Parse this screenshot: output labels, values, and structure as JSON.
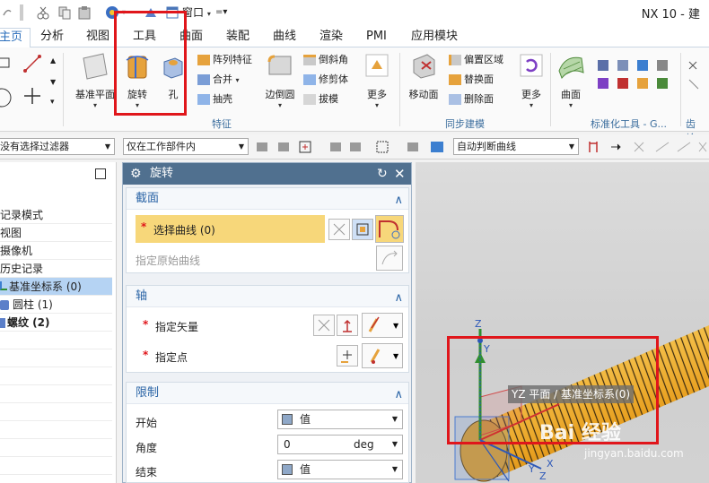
{
  "app_title": "NX 10 - 建",
  "quick_access": {
    "window_menu": "窗口"
  },
  "tabs": [
    "主页",
    "分析",
    "视图",
    "工具",
    "曲面",
    "装配",
    "曲线",
    "渲染",
    "PMI",
    "应用模块"
  ],
  "ribbon": {
    "datum_plane": "基准平面",
    "revolve": "旋转",
    "hole": "孔",
    "pattern_feature": "阵列特征",
    "unite": "合并",
    "shell": "抽壳",
    "edge_blend": "边倒圆",
    "chamfer": "倒斜角",
    "trim_body": "修剪体",
    "draft": "拔模",
    "more": "更多",
    "move_face": "移动面",
    "offset_region": "偏置区域",
    "replace_face": "替换面",
    "delete_face": "删除面",
    "surface": "曲面",
    "group_feature": "特征",
    "group_sync": "同步建模",
    "group_standard": "标准化工具 - G...",
    "group_gear": "齿轮..."
  },
  "filterbar": {
    "type_filter": "没有选择过滤器",
    "scope": "仅在工作部件内",
    "curve_rule": "自动判断曲线"
  },
  "nav": {
    "items": [
      {
        "label": "记录模式",
        "bold": false
      },
      {
        "label": "视图",
        "bold": false
      },
      {
        "label": "摄像机",
        "bold": false
      },
      {
        "label": "历史记录",
        "bold": false
      },
      {
        "label": "基准坐标系 (0)",
        "bold": false
      },
      {
        "label": "圆柱 (1)",
        "bold": false
      },
      {
        "label": "螺纹 (2)",
        "bold": true
      }
    ]
  },
  "dialog": {
    "title": "旋转",
    "section_profile": "截面",
    "select_curve": "选择曲线 (0)",
    "specify_origin_curve": "指定原始曲线",
    "section_axis": "轴",
    "specify_vector": "指定矢量",
    "specify_point": "指定点",
    "section_limits": "限制",
    "start": "开始",
    "start_value": "值",
    "angle": "角度",
    "angle_value": "0",
    "angle_unit": "deg",
    "end": "结束",
    "end_value": "值",
    "required": "*"
  },
  "viewport": {
    "tooltip": "YZ 平面 / 基准坐标系(0)",
    "axis_z": "Z",
    "axis_y": "Y",
    "axis_x": "X",
    "watermark_brand": "Bai 经验",
    "watermark_url": "jingyan.baidu.com"
  },
  "colors": {
    "accent": "#2a6ebb",
    "highlight_red": "#e0161b",
    "selection_yellow": "#f7d77a",
    "thread": "#e8a020",
    "dialog_title": "#50708f"
  }
}
